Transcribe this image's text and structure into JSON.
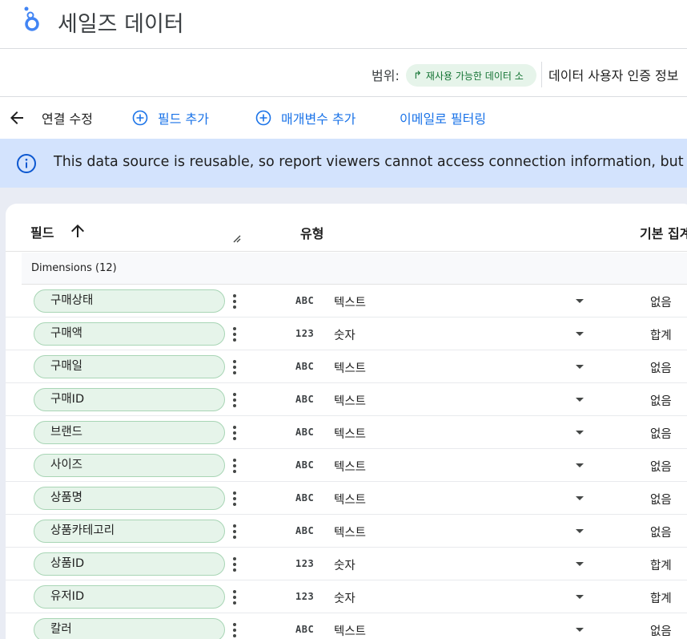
{
  "app": {
    "title": "세일즈 데이터"
  },
  "scope": {
    "label": "범위:",
    "chip_label": "재사용 가능한 데이터 소",
    "credentials_label": "데이터 사용자 인증 정보"
  },
  "toolbar": {
    "edit_connection": "연결 수정",
    "add_field": "필드 추가",
    "add_parameter": "매개변수 추가",
    "filter_by_email": "이메일로 필터링"
  },
  "banner": {
    "text": "This data source is reusable, so report viewers cannot access connection information, but have acc"
  },
  "table": {
    "columns": {
      "field": "필드",
      "type": "유형",
      "aggregation": "기본 집계"
    },
    "dimensions_label": "Dimensions (12)",
    "rows": [
      {
        "name": "구매상태",
        "type_code": "ABC",
        "type": "텍스트",
        "agg": "없음"
      },
      {
        "name": "구매액",
        "type_code": "123",
        "type": "숫자",
        "agg": "합계"
      },
      {
        "name": "구매일",
        "type_code": "ABC",
        "type": "텍스트",
        "agg": "없음"
      },
      {
        "name": "구매ID",
        "type_code": "ABC",
        "type": "텍스트",
        "agg": "없음"
      },
      {
        "name": "브랜드",
        "type_code": "ABC",
        "type": "텍스트",
        "agg": "없음"
      },
      {
        "name": "사이즈",
        "type_code": "ABC",
        "type": "텍스트",
        "agg": "없음"
      },
      {
        "name": "상품명",
        "type_code": "ABC",
        "type": "텍스트",
        "agg": "없음"
      },
      {
        "name": "상품카테고리",
        "type_code": "ABC",
        "type": "텍스트",
        "agg": "없음"
      },
      {
        "name": "상품ID",
        "type_code": "123",
        "type": "숫자",
        "agg": "합계"
      },
      {
        "name": "유저ID",
        "type_code": "123",
        "type": "숫자",
        "agg": "합계"
      },
      {
        "name": "칼러",
        "type_code": "ABC",
        "type": "텍스트",
        "agg": "없음"
      }
    ]
  },
  "colors": {
    "accent": "#1a73e8",
    "banner_bg": "#d3e3fd",
    "pill_bg": "#e6f4ea",
    "chip_text": "#137333"
  }
}
